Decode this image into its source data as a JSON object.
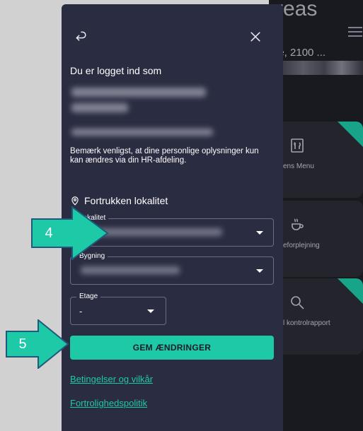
{
  "background": {
    "title": "reas",
    "address": "le, 2100 ...",
    "tiles": [
      {
        "label": "ens Menu",
        "icon": "menu-book-icon"
      },
      {
        "label": "eforplejning",
        "icon": "coffee-cup-icon"
      },
      {
        "label": "l kontrolrapport",
        "icon": "search-icon"
      }
    ]
  },
  "panel": {
    "logged_in_label": "Du er logget ind som",
    "notice": "Bemærk venligst, at dine personlige oplysninger kun kan ændres via din HR-afdeling.",
    "section_title": "Fortrukken lokalitet",
    "fields": {
      "location_label": "Lokalitet",
      "building_label": "Bygning",
      "floor_label": "Etage",
      "floor_value": "-"
    },
    "save_label": "GEM ÆNDRINGER",
    "terms_link": "Betingelser og vilkår",
    "privacy_link": "Fortrolighedspolitik"
  },
  "callouts": {
    "step4": "4",
    "step5": "5"
  },
  "colors": {
    "panel_bg": "#2a2c41",
    "accent": "#1ec9a7",
    "callout_fill": "#1ec9a7",
    "callout_border": "#1f5a7a"
  }
}
